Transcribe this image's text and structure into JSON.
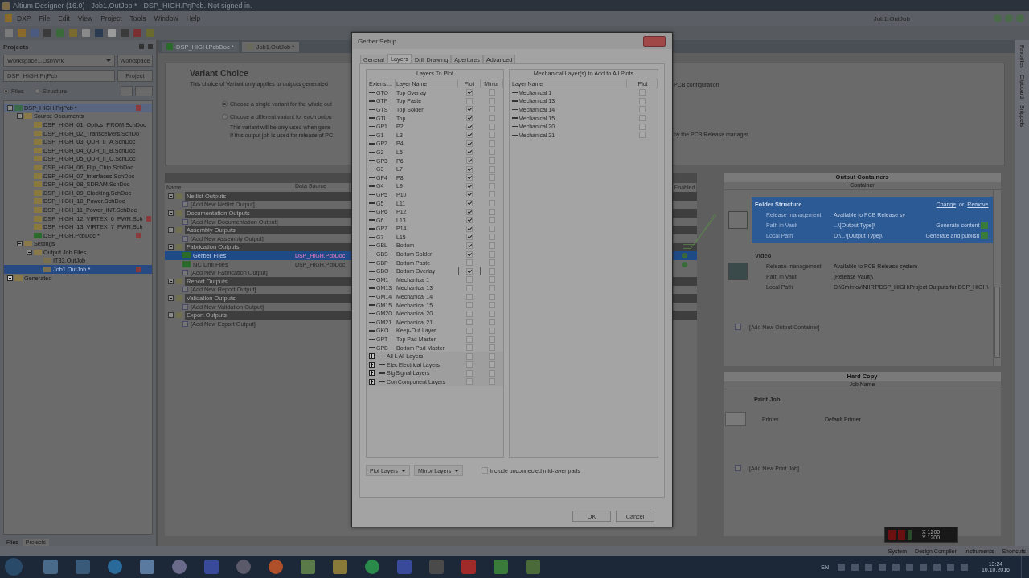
{
  "title_bar": {
    "title": "Altium Designer (16.0) - Job1.OutJob * - DSP_HIGH.PrjPcb. Not signed in."
  },
  "menu_bar": {
    "items": [
      "DXP",
      "File",
      "Edit",
      "View",
      "Project",
      "Tools",
      "Window",
      "Help"
    ],
    "document_name": "Job1.OutJob"
  },
  "projects_panel": {
    "title": "Projects",
    "workspace": "Workspace1.DsnWrk",
    "workspace_button": "Workspace",
    "project": "DSP_HIGH.PrjPcb",
    "project_button": "Project",
    "view_options": [
      {
        "label": "Files",
        "selected": true
      },
      {
        "label": "Structure",
        "selected": false
      }
    ],
    "tree": [
      {
        "kind": "project",
        "label": "DSP_HIGH.PrjPcb *",
        "selected": false,
        "expanded": true,
        "modified": true,
        "children": [
          {
            "kind": "folder",
            "label": "Source Documents",
            "selected": false,
            "expanded": true,
            "modified": false,
            "children": [
              {
                "kind": "schematic",
                "label": "DSP_HIGH_01_Optics_PROM.SchDoc",
                "selected": false,
                "modified": false
              },
              {
                "kind": "schematic",
                "label": "DSP_HIGH_02_Transceivers.SchDo",
                "selected": false,
                "modified": false
              },
              {
                "kind": "schematic",
                "label": "DSP_HIGH_03_QDR_II_A.SchDoc",
                "selected": false,
                "modified": false
              },
              {
                "kind": "schematic",
                "label": "DSP_HIGH_04_QDR_II_B.SchDoc",
                "selected": false,
                "modified": false
              },
              {
                "kind": "schematic",
                "label": "DSP_HIGH_05_QDR_II_C.SchDoc",
                "selected": false,
                "modified": false
              },
              {
                "kind": "schematic",
                "label": "DSP_HIGH_06_Flip_Chip.SchDoc",
                "selected": false,
                "modified": false
              },
              {
                "kind": "schematic",
                "label": "DSP_HIGH_07_Interfaces.SchDoc",
                "selected": false,
                "modified": false
              },
              {
                "kind": "schematic",
                "label": "DSP_HIGH_08_SDRAM.SchDoc",
                "selected": false,
                "modified": false
              },
              {
                "kind": "schematic",
                "label": "DSP_HIGH_09_Clocking.SchDoc",
                "selected": false,
                "modified": false
              },
              {
                "kind": "schematic",
                "label": "DSP_HIGH_10_Power.SchDoc",
                "selected": false,
                "modified": false
              },
              {
                "kind": "schematic",
                "label": "DSP_HIGH_11_Power_INT.SchDoc",
                "selected": false,
                "modified": false
              },
              {
                "kind": "schematic",
                "label": "DSP_HIGH_12_VIRTEX_6_PWR.Sch",
                "selected": false,
                "modified": true
              },
              {
                "kind": "schematic",
                "label": "DSP_HIGH_13_VIRTEX_7_PWR.Sch",
                "selected": false,
                "modified": false
              },
              {
                "kind": "pcb",
                "label": "DSP_HIGH.PcbDoc *",
                "selected": false,
                "modified": true
              }
            ]
          },
          {
            "kind": "folder",
            "label": "Settings",
            "selected": false,
            "expanded": true,
            "modified": false,
            "children": [
              {
                "kind": "folder",
                "label": "Output Job Files",
                "selected": false,
                "expanded": true,
                "modified": false,
                "children": [
                  {
                    "kind": "outjob",
                    "label": "IT33.OutJob",
                    "selected": false,
                    "modified": false
                  },
                  {
                    "kind": "outjob",
                    "label": "Job1.OutJob *",
                    "selected": true,
                    "modified": true
                  }
                ]
              }
            ]
          }
        ]
      },
      {
        "kind": "folder",
        "label": "Generated",
        "selected": false,
        "expanded": false,
        "modified": false
      }
    ],
    "tabs": [
      {
        "label": "Files",
        "selected": false
      },
      {
        "label": "Projects",
        "selected": true
      }
    ]
  },
  "document_tabs": [
    {
      "label": "DSP_HIGH.PcbDoc *",
      "selected": false
    },
    {
      "label": "Job1.OutJob *",
      "selected": true
    }
  ],
  "variant_choice": {
    "title": "Variant Choice",
    "description": "This choice of Variant only applies to outputs generated",
    "description_end": "PCB configuration",
    "options": [
      {
        "label": "Choose a single variant for the whole out",
        "selected": true
      },
      {
        "label": "Choose a different variant for each outpu",
        "selected": false
      }
    ],
    "note_lines": [
      "This variant will be only used when gene",
      "If this output job is used for release of PC"
    ],
    "note_end": "by the PCB Release manager."
  },
  "outputs_table": {
    "columns": [
      "Name",
      "Data Source",
      "Enabled"
    ],
    "groups": [
      {
        "name": "Netlist Outputs",
        "items": [
          {
            "kind": "add",
            "name": "[Add New Netlist Output]"
          }
        ]
      },
      {
        "name": "Documentation Outputs",
        "items": [
          {
            "kind": "add",
            "name": "[Add New Documentation Output]"
          }
        ]
      },
      {
        "name": "Assembly Outputs",
        "items": [
          {
            "kind": "add",
            "name": "[Add New Assembly Output]"
          }
        ]
      },
      {
        "name": "Fabrication Outputs",
        "items": [
          {
            "kind": "output",
            "name": "Gerber Files",
            "data_source": "DSP_HIGH.PcbDoc",
            "selected": true,
            "enabled": true
          },
          {
            "kind": "output",
            "name": "NC Drill Files",
            "data_source": "DSP_HIGH.PcbDoc",
            "selected": false,
            "enabled": true
          },
          {
            "kind": "add",
            "name": "[Add New Fabrication Output]"
          }
        ]
      },
      {
        "name": "Report Outputs",
        "items": [
          {
            "kind": "add",
            "name": "[Add New Report Output]"
          }
        ]
      },
      {
        "name": "Validation Outputs",
        "items": [
          {
            "kind": "add",
            "name": "[Add New Validation Output]"
          }
        ]
      },
      {
        "name": "Export Outputs",
        "items": [
          {
            "kind": "add",
            "name": "[Add New Export Output]"
          }
        ]
      }
    ]
  },
  "output_containers": {
    "title": "Output Containers",
    "column": "Container",
    "containers": [
      {
        "kind": "folder",
        "name": "Folder Structure",
        "selected": true,
        "links": [
          "Change",
          "Remove"
        ],
        "separator": "or",
        "fields": [
          {
            "label": "Release management",
            "value": "Available to PCB Release sy"
          },
          {
            "label": "Path in Vault",
            "value": "...\\[Output Type]\\",
            "action": "Generate content"
          },
          {
            "label": "Local Path",
            "value": "D:\\...\\[Output Type]\\",
            "action": "Generate and publish"
          }
        ]
      },
      {
        "kind": "video",
        "name": "Video",
        "selected": false,
        "fields": [
          {
            "label": "Release management",
            "value": "Available to PCB Release system"
          },
          {
            "label": "Path in Vault",
            "value": "[Release Vault]\\"
          },
          {
            "label": "Local Path",
            "value": "D:\\Smirnov\\NIIRT\\DSP_HIGH\\Project Outputs for DSP_HIGH\\"
          }
        ]
      }
    ],
    "add_label": "[Add New Output Container]"
  },
  "hard_copy": {
    "title": "Hard Copy",
    "column": "Job Name",
    "jobs": [
      {
        "name": "Print Job",
        "printer_label": "Printer",
        "printer": "Default Printer"
      }
    ],
    "add_label": "[Add New Print Job]"
  },
  "side_tabs": [
    "Favorites",
    "Clipboard",
    "Snippets"
  ],
  "gerber_dialog": {
    "title": "Gerber Setup",
    "tabs": [
      {
        "label": "General",
        "selected": false
      },
      {
        "label": "Layers",
        "selected": true
      },
      {
        "label": "Drill Drawing",
        "selected": false
      },
      {
        "label": "Apertures",
        "selected": false
      },
      {
        "label": "Advanced",
        "selected": false
      }
    ],
    "layers_table": {
      "title": "Layers To Plot",
      "columns": [
        "Extensi...",
        "Layer Name",
        "Plot",
        "Mirror"
      ],
      "rows": [
        {
          "kind": "layer",
          "extension": "GTO",
          "name": "Top Overlay",
          "plot": true,
          "mirror": false,
          "focused": false
        },
        {
          "kind": "layer",
          "extension": "GTP",
          "name": "Top Paste",
          "plot": false,
          "mirror": false,
          "focused": false
        },
        {
          "kind": "layer",
          "extension": "GTS",
          "name": "Top Solder",
          "plot": true,
          "mirror": false,
          "focused": false
        },
        {
          "kind": "layer",
          "extension": "GTL",
          "name": "Top",
          "plot": true,
          "mirror": false,
          "focused": false
        },
        {
          "kind": "layer",
          "extension": "GP1",
          "name": "P2",
          "plot": true,
          "mirror": false,
          "focused": false
        },
        {
          "kind": "layer",
          "extension": "G1",
          "name": "L3",
          "plot": true,
          "mirror": false,
          "focused": false
        },
        {
          "kind": "layer",
          "extension": "GP2",
          "name": "P4",
          "plot": true,
          "mirror": false,
          "focused": false
        },
        {
          "kind": "layer",
          "extension": "G2",
          "name": "L5",
          "plot": true,
          "mirror": false,
          "focused": false
        },
        {
          "kind": "layer",
          "extension": "GP3",
          "name": "P6",
          "plot": true,
          "mirror": false,
          "focused": false
        },
        {
          "kind": "layer",
          "extension": "G3",
          "name": "L7",
          "plot": true,
          "mirror": false,
          "focused": false
        },
        {
          "kind": "layer",
          "extension": "GP4",
          "name": "P8",
          "plot": true,
          "mirror": false,
          "focused": false
        },
        {
          "kind": "layer",
          "extension": "G4",
          "name": "L9",
          "plot": true,
          "mirror": false,
          "focused": false
        },
        {
          "kind": "layer",
          "extension": "GP5",
          "name": "P10",
          "plot": true,
          "mirror": false,
          "focused": false
        },
        {
          "kind": "layer",
          "extension": "G5",
          "name": "L11",
          "plot": true,
          "mirror": false,
          "focused": false
        },
        {
          "kind": "layer",
          "extension": "GP6",
          "name": "P12",
          "plot": true,
          "mirror": false,
          "focused": false
        },
        {
          "kind": "layer",
          "extension": "G6",
          "name": "L13",
          "plot": true,
          "mirror": false,
          "focused": false
        },
        {
          "kind": "layer",
          "extension": "GP7",
          "name": "P14",
          "plot": true,
          "mirror": false,
          "focused": false
        },
        {
          "kind": "layer",
          "extension": "G7",
          "name": "L15",
          "plot": true,
          "mirror": false,
          "focused": false
        },
        {
          "kind": "layer",
          "extension": "GBL",
          "name": "Bottom",
          "plot": true,
          "mirror": false,
          "focused": false
        },
        {
          "kind": "layer",
          "extension": "GBS",
          "name": "Bottom Solder",
          "plot": true,
          "mirror": false,
          "focused": false
        },
        {
          "kind": "layer",
          "extension": "GBP",
          "name": "Bottom Paste",
          "plot": false,
          "mirror": false,
          "focused": false
        },
        {
          "kind": "layer",
          "extension": "GBO",
          "name": "Bottom Overlay",
          "plot": true,
          "mirror": false,
          "focused": true
        },
        {
          "kind": "layer",
          "extension": "GM1",
          "name": "Mechanical 1",
          "plot": false,
          "mirror": false,
          "focused": false
        },
        {
          "kind": "layer",
          "extension": "GM13",
          "name": "Mechanical 13",
          "plot": false,
          "mirror": false,
          "focused": false
        },
        {
          "kind": "layer",
          "extension": "GM14",
          "name": "Mechanical 14",
          "plot": false,
          "mirror": false,
          "focused": false
        },
        {
          "kind": "layer",
          "extension": "GM15",
          "name": "Mechanical 15",
          "plot": false,
          "mirror": false,
          "focused": false
        },
        {
          "kind": "layer",
          "extension": "GM20",
          "name": "Mechanical 20",
          "plot": false,
          "mirror": false,
          "focused": false
        },
        {
          "kind": "layer",
          "extension": "GM21",
          "name": "Mechanical 21",
          "plot": false,
          "mirror": false,
          "focused": false
        },
        {
          "kind": "layer",
          "extension": "GKO",
          "name": "Keep-Out Layer",
          "plot": false,
          "mirror": false,
          "focused": false
        },
        {
          "kind": "layer",
          "extension": "GPT",
          "name": "Top Pad Master",
          "plot": false,
          "mirror": false,
          "focused": false
        },
        {
          "kind": "layer",
          "extension": "GPB",
          "name": "Bottom Pad Master",
          "plot": false,
          "mirror": false,
          "focused": false
        },
        {
          "kind": "group",
          "extension": "All L",
          "name": "All Layers",
          "plot": false,
          "mirror": false,
          "expanded": false
        },
        {
          "kind": "group",
          "extension": "Elec",
          "name": "Electrical Layers",
          "plot": false,
          "mirror": false,
          "expanded": false
        },
        {
          "kind": "group",
          "extension": "Sig",
          "name": "Signal Layers",
          "plot": false,
          "mirror": false,
          "expanded": false
        },
        {
          "kind": "group",
          "extension": "Con",
          "name": "Component Layers",
          "plot": false,
          "mirror": false,
          "expanded": false
        }
      ]
    },
    "mechanical_table": {
      "title": "Mechanical Layer(s) to Add to All Plots",
      "columns": [
        "Layer Name",
        "Plot"
      ],
      "rows": [
        {
          "name": "Mechanical 1",
          "plot": false
        },
        {
          "name": "Mechanical 13",
          "plot": false
        },
        {
          "name": "Mechanical 14",
          "plot": false
        },
        {
          "name": "Mechanical 15",
          "plot": false
        },
        {
          "name": "Mechanical 20",
          "plot": false
        },
        {
          "name": "Mechanical 21",
          "plot": false
        }
      ]
    },
    "plot_layers_button": "Plot Layers",
    "mirror_layers_button": "Mirror Layers",
    "include_pads": {
      "label": "Include unconnected mid-layer pads",
      "checked": false
    },
    "buttons": [
      "OK",
      "Cancel"
    ]
  },
  "status_bar": {
    "items": [
      "System",
      "Design Compiler",
      "Instruments",
      "Shortcuts"
    ]
  },
  "coordinates": {
    "x": "X 1200",
    "y": "Y 1200"
  },
  "taskbar": {
    "language": "EN",
    "time": "13:24",
    "date": "10.10.2016"
  }
}
